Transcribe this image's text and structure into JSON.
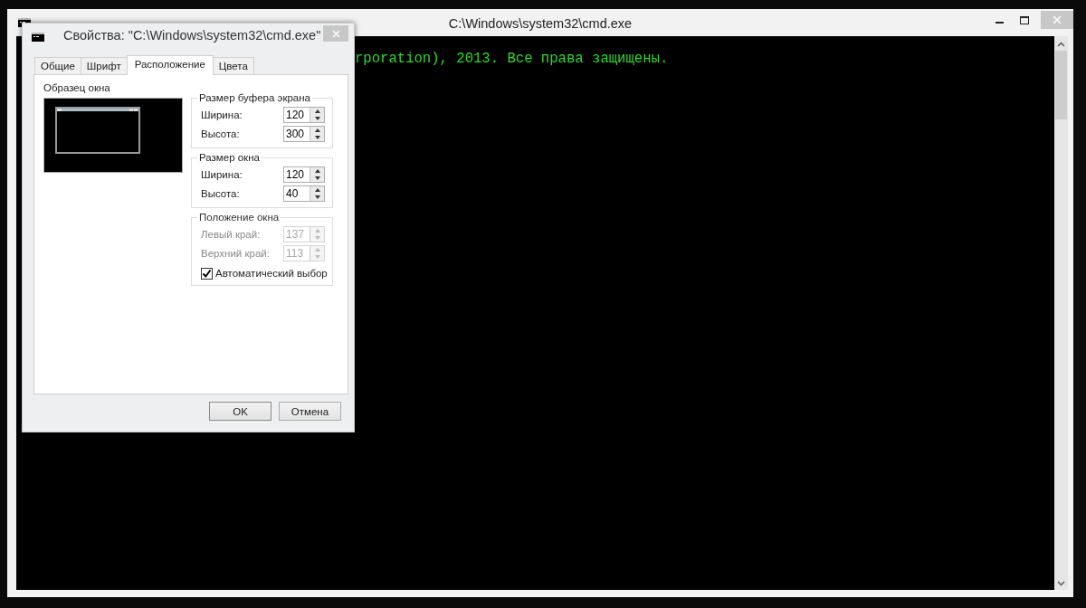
{
  "console_window": {
    "title": "C:\\Windows\\system32\\cmd.exe",
    "lines": [
      {
        "text": "rporation), 2013. Все права защищены."
      }
    ]
  },
  "properties_dialog": {
    "title": "Свойства: \"C:\\Windows\\system32\\cmd.exe\"",
    "tabs": [
      {
        "label": "Общие",
        "selected": false
      },
      {
        "label": "Шрифт",
        "selected": false
      },
      {
        "label": "Расположение",
        "selected": true
      },
      {
        "label": "Цвета",
        "selected": false
      }
    ],
    "sample_label": "Образец окна",
    "groups": [
      {
        "title": "Размер буфера экрана",
        "disabled": false,
        "fields": [
          {
            "label": "Ширина:",
            "value": "120"
          },
          {
            "label": "Высота:",
            "value": "300"
          }
        ]
      },
      {
        "title": "Размер окна",
        "disabled": false,
        "fields": [
          {
            "label": "Ширина:",
            "value": "120"
          },
          {
            "label": "Высота:",
            "value": "40"
          }
        ]
      },
      {
        "title": "Положение окна",
        "disabled": true,
        "fields": [
          {
            "label": "Левый край:",
            "value": "137"
          },
          {
            "label": "Верхний край:",
            "value": "113"
          }
        ],
        "checkbox": {
          "label": "Автоматический выбор",
          "checked": true
        }
      }
    ],
    "buttons": [
      "OK",
      "Отмена"
    ]
  }
}
